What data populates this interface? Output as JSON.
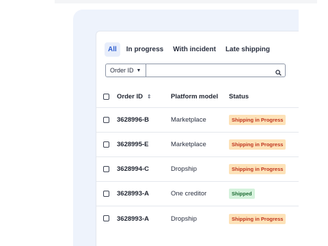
{
  "tabs": [
    {
      "label": "All",
      "active": true
    },
    {
      "label": "In progress",
      "active": false
    },
    {
      "label": "With incident",
      "active": false
    },
    {
      "label": "Late shipping",
      "active": false
    }
  ],
  "filter": {
    "select_value": "Order ID",
    "search_value": "",
    "search_placeholder": ""
  },
  "table": {
    "columns": {
      "order_id": "Order ID",
      "platform_model": "Platform model",
      "status": "Status"
    },
    "rows": [
      {
        "order_id": "3628996-B",
        "platform_model": "Marketplace",
        "status": "Shipping in Progress",
        "status_kind": "progress"
      },
      {
        "order_id": "3628995-E",
        "platform_model": "Marketplace",
        "status": "Shipping in Progress",
        "status_kind": "progress"
      },
      {
        "order_id": "3628994-C",
        "platform_model": "Dropship",
        "status": "Shipping in Progress",
        "status_kind": "progress"
      },
      {
        "order_id": "3628993-A",
        "platform_model": "One creditor",
        "status": "Shipped",
        "status_kind": "shipped"
      },
      {
        "order_id": "3628993-A",
        "platform_model": "Dropship",
        "status": "Shipping in Progress",
        "status_kind": "progress"
      }
    ]
  },
  "colors": {
    "accent": "#2f5fd0",
    "progress_bg": "#fde2b8",
    "progress_text": "#c0341d",
    "shipped_bg": "#d5f2dc",
    "shipped_text": "#1d6b33"
  },
  "icons": {
    "search": "search-icon",
    "select": "chevron-down-icon",
    "sort": "sort-icon"
  }
}
